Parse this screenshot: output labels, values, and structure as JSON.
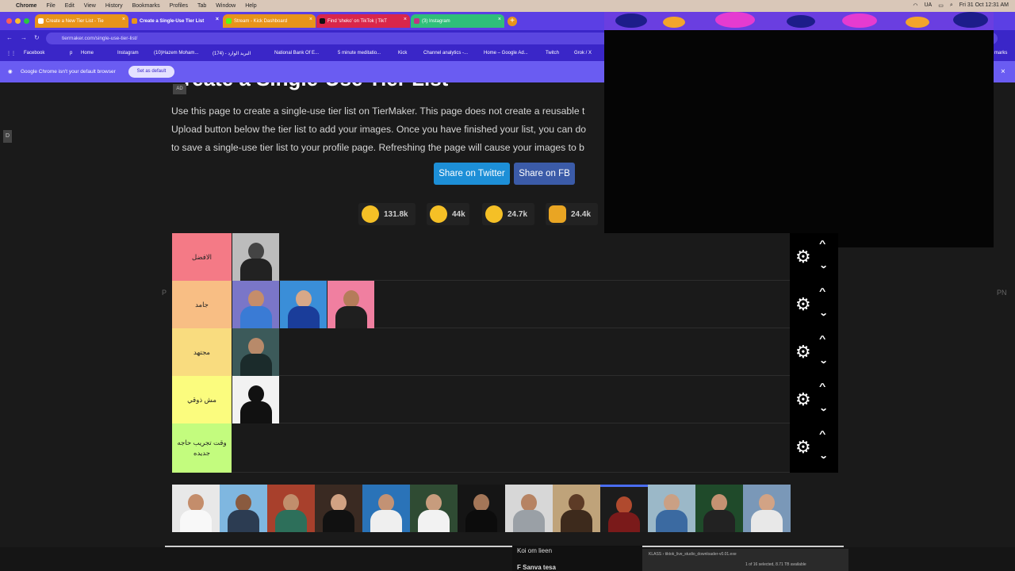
{
  "menubar": {
    "items": [
      "Chrome",
      "File",
      "Edit",
      "View",
      "History",
      "Bookmarks",
      "Profiles",
      "Tab",
      "Window",
      "Help"
    ],
    "clock": "Fri 31 Oct  12:31 AM",
    "lang": "UA"
  },
  "tabs": [
    {
      "title": "Create a New Tier List - Tie",
      "color": "#e8941a"
    },
    {
      "title": "Create a Single-Use Tier List",
      "color": "#5b3fe4"
    },
    {
      "title": "Stream - Kick Dashboard",
      "color": "#e8941a"
    },
    {
      "title": "Find 'sheko' on TikTok | TikT",
      "color": "#d9264a"
    },
    {
      "title": "(3) Instagram",
      "color": "#2fbf7a"
    }
  ],
  "address": {
    "url": "tiermaker.com/single-use-tier-list/"
  },
  "bookmarks": [
    "Facebook",
    "p",
    "Home",
    "Instagram",
    "(10)Hazem Moham...",
    "(174) - البريد الوارد",
    "National Bank Of E...",
    "5 minute meditatio...",
    "Kick",
    "Channel analytics -...",
    "Home – Google Ad...",
    "Twitch",
    "Grok / X"
  ],
  "bookmarks_overflow": "marks",
  "infobar": {
    "message": "Google Chrome isn't your default browser",
    "button": "Set as default",
    "close": "×"
  },
  "page": {
    "ad_label": "AD",
    "heading": "reate a Single-Use Tier List",
    "description": [
      "Use this page to create a single-use tier list on TierMaker. This page does not create a reusable t",
      "Upload button below the tier list to add your images. Once you have finished your list, you can do",
      "to save a single-use tier list to your profile page. Refreshing the page will cause your images to b"
    ],
    "share_twitter": "Share on Twitter",
    "share_fb": "Share on FB",
    "reactions": [
      {
        "icon": "smiley-emoji-icon",
        "count": "131.8k"
      },
      {
        "icon": "heart-eyes-emoji-icon",
        "count": "44k"
      },
      {
        "icon": "laughing-emoji-icon",
        "count": "24.7k"
      },
      {
        "icon": "raised-hands-emoji-icon",
        "count": "24.4k"
      }
    ],
    "side_left": "P",
    "side_right": "PN",
    "side_tag": "D"
  },
  "tiers": [
    {
      "label": "الافضل",
      "color": "#f47a86",
      "images": 1
    },
    {
      "label": "جامد",
      "color": "#f8be84",
      "images": 3
    },
    {
      "label": "مجتهد",
      "color": "#f9dc7f",
      "images": 1
    },
    {
      "label": "مش ذوقي",
      "color": "#fbfc7e",
      "images": 1
    },
    {
      "label": "وقت تجريب حاجه جديده",
      "color": "#c3fc7e",
      "images": 0
    }
  ],
  "pool_count": 13,
  "taskbar": {
    "thumb1_line1": "Koi om lieen",
    "thumb1_line2": "F Sanva tesa",
    "thumb2_line1": "KLASS  ›  tiktok_live_studio_downloader-v0.01.exe",
    "thumb2_line2": "1 of 16 selected, 8.71 TB available"
  }
}
